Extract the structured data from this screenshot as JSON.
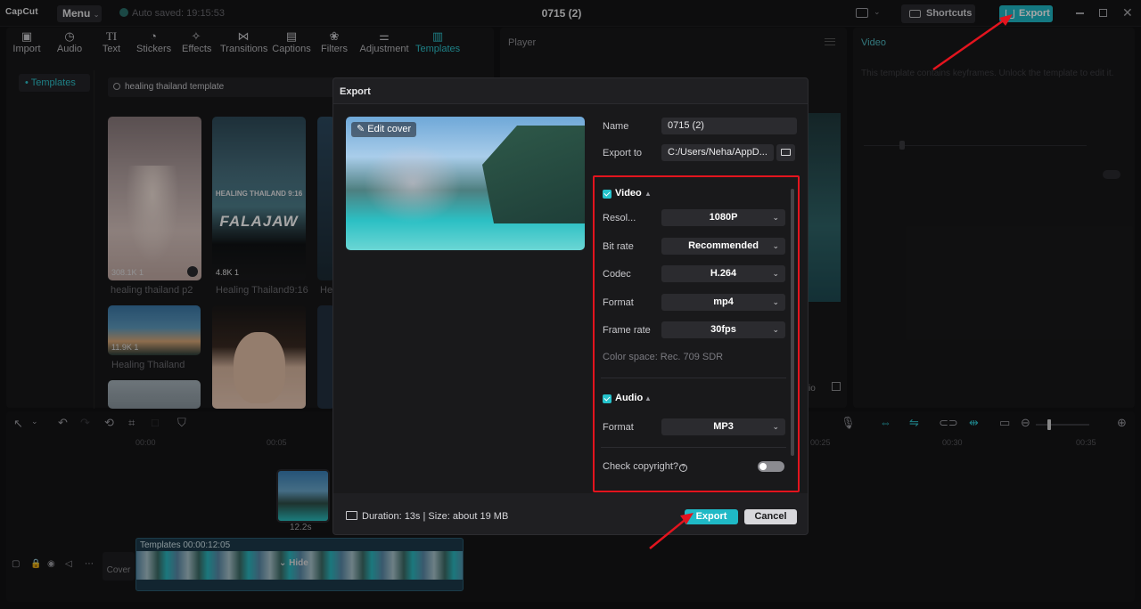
{
  "app": {
    "logo": "CapCut",
    "menu_label": "Menu",
    "autosave": "Auto saved: 19:15:53",
    "title": "0715 (2)"
  },
  "titlebar": {
    "shortcuts_label": "Shortcuts",
    "export_label": "Export"
  },
  "toolbar": {
    "items": [
      {
        "label": "Import",
        "icon": "import-icon"
      },
      {
        "label": "Audio",
        "icon": "audio-icon"
      },
      {
        "label": "Text",
        "icon": "text-icon"
      },
      {
        "label": "Stickers",
        "icon": "stickers-icon"
      },
      {
        "label": "Effects",
        "icon": "effects-icon"
      },
      {
        "label": "Transitions",
        "icon": "transitions-icon"
      },
      {
        "label": "Captions",
        "icon": "captions-icon"
      },
      {
        "label": "Filters",
        "icon": "filters-icon"
      },
      {
        "label": "Adjustment",
        "icon": "adjustment-icon"
      },
      {
        "label": "Templates",
        "icon": "templates-icon"
      }
    ],
    "active": "Templates"
  },
  "left_nav": {
    "item": "• Templates"
  },
  "search": {
    "value": "healing thailand template"
  },
  "templates": [
    {
      "stats": "308.1K  1",
      "name": "healing thailand p2"
    },
    {
      "stats": "4.8K  1",
      "name": "Healing Thailand9:16",
      "overlay": "HEALING THAILAND 9:16"
    },
    {
      "name": "He"
    },
    {
      "stats": "11.9K  1",
      "name": "Healing Thailand"
    }
  ],
  "player": {
    "title": "Player"
  },
  "right_panel": {
    "title": "Video",
    "note": "This template contains keyframes. Unlock the template to edit it."
  },
  "timeline": {
    "ruler": [
      "00:00",
      "00:05",
      "00:25",
      "00:30",
      "00:35"
    ],
    "clip_duration": "12.2s",
    "cover_label": "Cover",
    "track_label": "Templates  00:00:12:05",
    "hide_label": "Hide"
  },
  "modal": {
    "title": "Export",
    "edit_cover": "Edit cover",
    "name_label": "Name",
    "name_value": "0715 (2)",
    "export_to_label": "Export to",
    "export_to_value": "C:/Users/Neha/AppD...",
    "video_label": "Video",
    "resolution_label": "Resol...",
    "resolution_value": "1080P",
    "bitrate_label": "Bit rate",
    "bitrate_value": "Recommended",
    "codec_label": "Codec",
    "codec_value": "H.264",
    "format_label": "Format",
    "format_value": "mp4",
    "framerate_label": "Frame rate",
    "framerate_value": "30fps",
    "color_space": "Color space: Rec. 709 SDR",
    "audio_label": "Audio",
    "audio_format_label": "Format",
    "audio_format_value": "MP3",
    "copyright_label": "Check copyright?",
    "duration": "Duration: 13s | Size: about 19 MB",
    "export_label": "Export",
    "cancel_label": "Cancel"
  },
  "colors": {
    "accent": "#1fb9c6",
    "highlight": "#e3141e"
  }
}
